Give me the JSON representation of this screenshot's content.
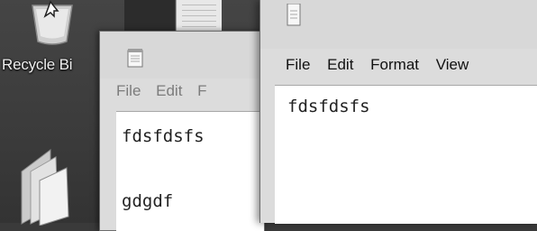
{
  "desktop": {
    "recycle_bin_label": "Recycle Bi"
  },
  "back_window": {
    "menu": [
      "File",
      "Edit",
      "F"
    ],
    "lines": [
      "fdsfdsfs",
      "gdgdf"
    ]
  },
  "front_window": {
    "menu": [
      "File",
      "Edit",
      "Format",
      "View"
    ],
    "lines": [
      "fdsfdsfs"
    ]
  },
  "icons": [
    "recycle-bin-icon",
    "folder-icon",
    "notepad-icon"
  ]
}
